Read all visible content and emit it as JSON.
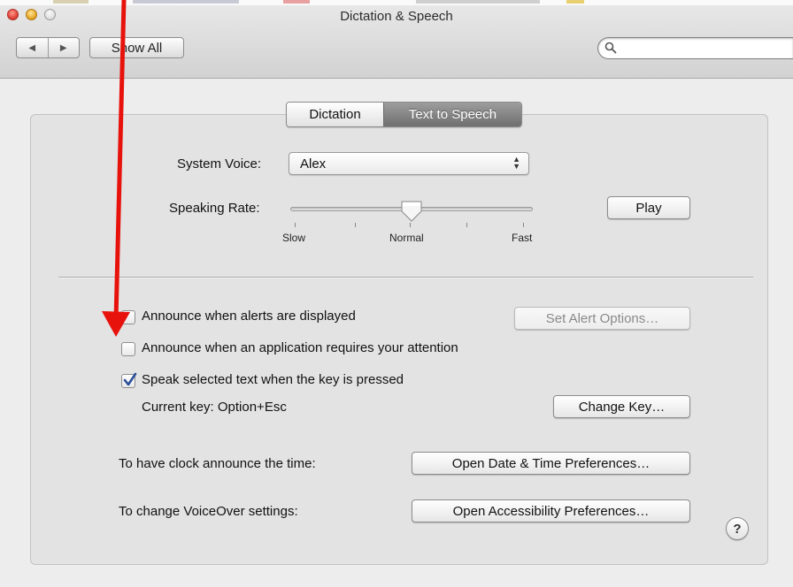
{
  "window": {
    "title": "Dictation & Speech"
  },
  "toolbar": {
    "back_glyph": "◀",
    "forward_glyph": "▶",
    "show_all_label": "Show All",
    "search_value": "",
    "search_placeholder": ""
  },
  "tabs": {
    "dictation_label": "Dictation",
    "tts_label": "Text to Speech",
    "selected": "Text to Speech"
  },
  "voice": {
    "label": "System Voice:",
    "value": "Alex"
  },
  "rate": {
    "label": "Speaking Rate:",
    "slow_label": "Slow",
    "normal_label": "Normal",
    "fast_label": "Fast",
    "level_fraction": 0.5,
    "play_label": "Play"
  },
  "options": {
    "alerts_label": "Announce when alerts are displayed",
    "alerts_checked": false,
    "set_alert_options_label": "Set Alert Options…",
    "attention_label": "Announce when an application requires your attention",
    "attention_checked": false,
    "speak_selected_label": "Speak selected text when the key is pressed",
    "speak_selected_checked": true,
    "current_key_label": "Current key: Option+Esc",
    "change_key_label": "Change Key…"
  },
  "links": {
    "clock_label": "To have clock announce the time:",
    "date_time_button": "Open Date & Time Preferences…",
    "voiceover_label": "To change VoiceOver settings:",
    "accessibility_button": "Open Accessibility Preferences…"
  },
  "help": {
    "glyph": "?"
  },
  "colors": {
    "annotation_arrow": "#e8120c",
    "checkbox_check": "#2a4f9a",
    "selected_tab": "#858585"
  }
}
